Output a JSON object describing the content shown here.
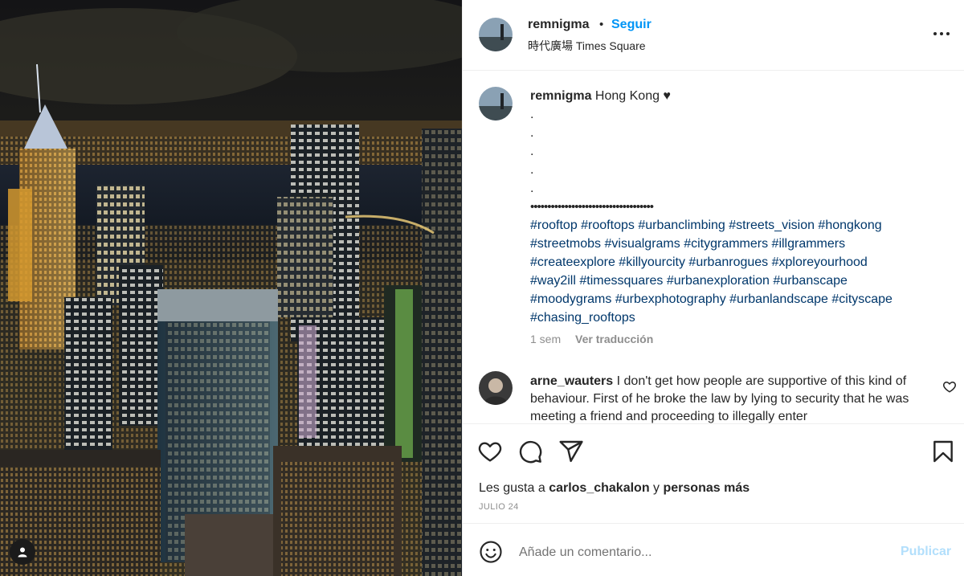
{
  "post": {
    "username": "remnigma",
    "separator": "•",
    "follow_label": "Seguir",
    "location": "時代廣場 Times Square"
  },
  "caption": {
    "username": "remnigma",
    "text": "Hong Kong ♥",
    "dot_lines": [
      ".",
      ".",
      ".",
      ".",
      "."
    ],
    "bullets": "••••••••••••••••••••••••••••••••••••",
    "hashtag_lines": [
      "#rooftop #rooftops #urbanclimbing #streets_vision #hongkong",
      "#streetmobs #visualgrams #citygrammers #illgrammers",
      "#createexplore #killyourcity #urbanrogues #xploreyourhood",
      "#way2ill #timessquares #urbanexploration #urbanscape",
      "#moodygrams #urbexphotography #urbanlandscape #cityscape",
      "#chasing_rooftops"
    ],
    "age": "1 sem",
    "translate_label": "Ver traducción"
  },
  "comment": {
    "username": "arne_wauters",
    "text": "I don't get how people are supportive of this kind of behaviour. First of he broke the law by lying to security that he was meeting a friend and proceeding to illegally enter"
  },
  "likes": {
    "prefix": "Les gusta a",
    "liker": "carlos_chakalon",
    "connector": "y",
    "others": "personas más"
  },
  "date": "JULIO 24",
  "composer": {
    "placeholder": "Añade un comentario...",
    "publish_label": "Publicar"
  },
  "icons": {
    "like": "heart-icon",
    "comment": "comment-bubble-icon",
    "share": "paper-plane-icon",
    "save": "bookmark-icon",
    "emoji": "smiley-icon",
    "more": "more-options-icon",
    "tagged_user": "user-icon"
  },
  "colors": {
    "link_blue": "#0095f6",
    "hashtag": "#00376b",
    "muted": "#8e8e8e",
    "publish_disabled": "#b2dffc"
  }
}
